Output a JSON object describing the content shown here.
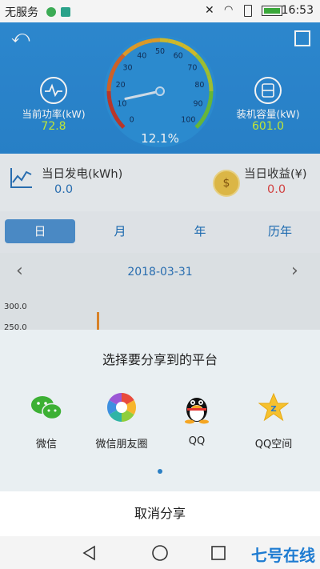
{
  "status_bar": {
    "carrier": "无服务",
    "time": "16:53"
  },
  "header": {
    "power_label": "当前功率(kW)",
    "power_value": "72.8",
    "capacity_label": "装机容量(kW)",
    "capacity_value": "601.0",
    "gauge": {
      "percent_label": "12.1%",
      "value_percent": 12.1,
      "ticks": [
        "0",
        "10",
        "20",
        "30",
        "40",
        "50",
        "60",
        "70",
        "80",
        "90",
        "100"
      ]
    }
  },
  "stats": {
    "daily_gen_label": "当日发电(kWh)",
    "daily_gen_value": "0.0",
    "daily_income_label": "当日收益(¥)",
    "daily_income_value": "0.0"
  },
  "tabs": [
    {
      "label": "日",
      "active": true
    },
    {
      "label": "月",
      "active": false
    },
    {
      "label": "年",
      "active": false
    },
    {
      "label": "历年",
      "active": false
    }
  ],
  "date_nav": {
    "date": "2018-03-31"
  },
  "chart": {
    "ytick_top": "300.0",
    "ytick_partial": "250.0"
  },
  "share_sheet": {
    "title": "选择要分享到的平台",
    "options": [
      {
        "label": "微信",
        "icon": "wechat-icon"
      },
      {
        "label": "微信朋友圈",
        "icon": "moments-icon"
      },
      {
        "label": "QQ",
        "icon": "qq-icon"
      },
      {
        "label": "QQ空间",
        "icon": "qzone-icon"
      }
    ],
    "cancel_label": "取消分享"
  },
  "watermark": "七号在线"
}
